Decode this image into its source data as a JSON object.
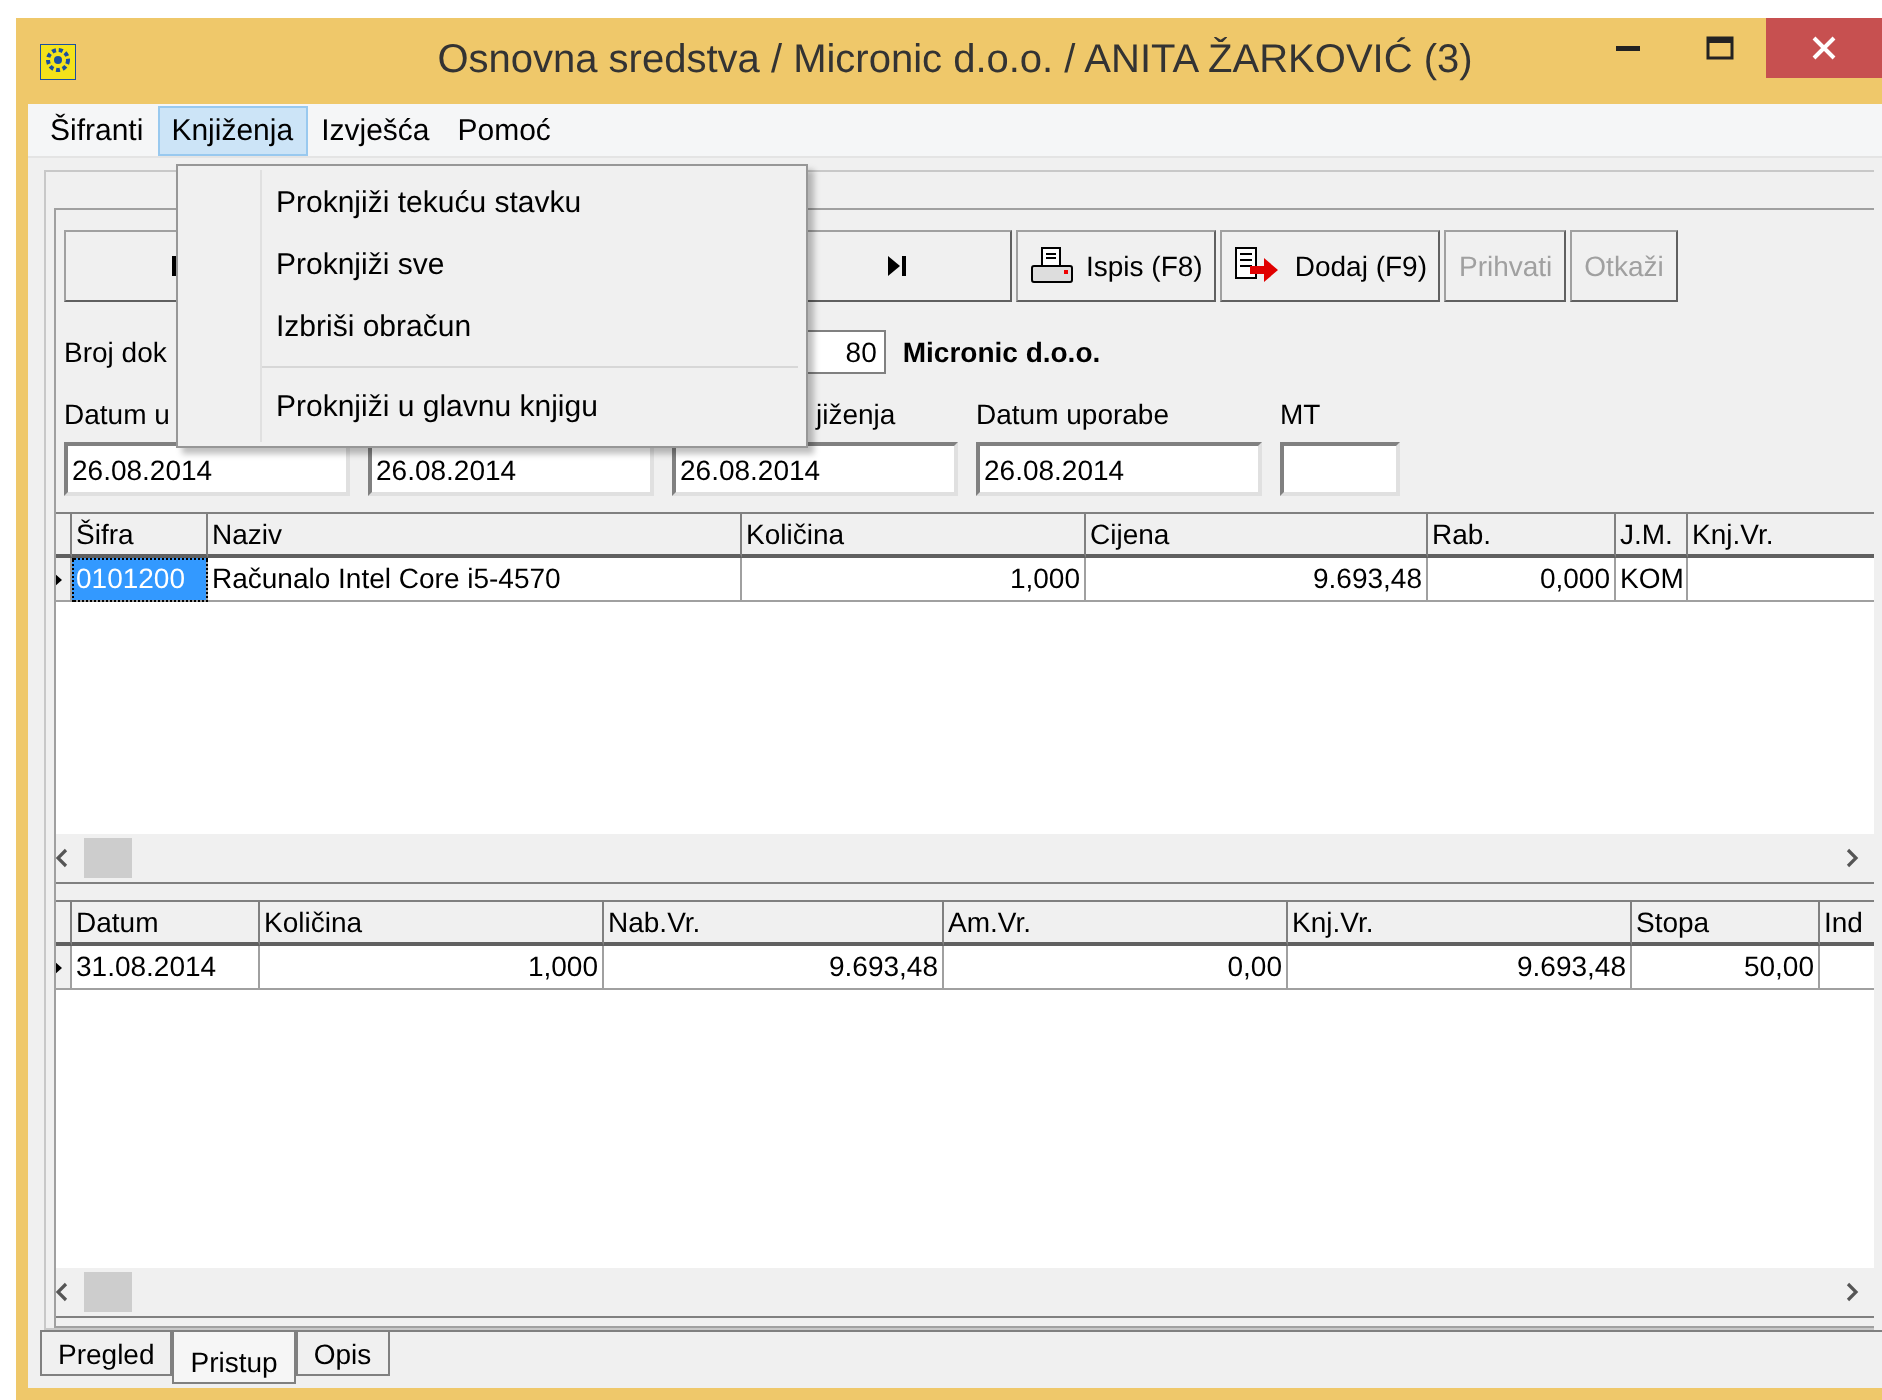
{
  "window": {
    "title": "Osnovna sredstva / Micronic d.o.o.  / ANITA ŽARKOVIĆ (3)"
  },
  "menu": [
    {
      "label": "Šifranti",
      "selected": false
    },
    {
      "label": "Knjiženja",
      "selected": true
    },
    {
      "label": "Izvješća",
      "selected": false
    },
    {
      "label": "Pomoć",
      "selected": false
    }
  ],
  "dropdown": [
    {
      "kind": "item",
      "label": "Proknjiži tekuću stavku"
    },
    {
      "kind": "item",
      "label": "Proknjiži sve"
    },
    {
      "kind": "item",
      "label": "Izbriši obračun"
    },
    {
      "kind": "separator"
    },
    {
      "kind": "item",
      "label": "Proknjiži u glavnu knjigu"
    }
  ],
  "toolbar": [
    {
      "kind": "first"
    },
    {
      "kind": "last"
    },
    {
      "kind": "print",
      "label": "Ispis (F8)",
      "disabled": false
    },
    {
      "kind": "add",
      "label": "Dodaj (F9)",
      "disabled": false
    },
    {
      "kind": "text",
      "label": "Prihvati",
      "disabled": true
    },
    {
      "kind": "text",
      "label": "Otkaži",
      "disabled": true
    }
  ],
  "document": {
    "label": "Broj dok",
    "number": "80",
    "company": "Micronic d.o.o."
  },
  "date_fields": [
    {
      "label": "Datum u",
      "value": "26.08.2014",
      "label_cut": false
    },
    {
      "value": "26.08.2014"
    },
    {
      "label": "jiženja",
      "value": "26.08.2014",
      "label_cut": true
    },
    {
      "label": "Datum uporabe",
      "value": "26.08.2014",
      "label_cut": false
    },
    {
      "label": "MT",
      "label_cut": false
    }
  ],
  "items_table": {
    "columns": [
      {
        "label": "Šifra",
        "kind": "text"
      },
      {
        "label": "Naziv",
        "kind": "text"
      },
      {
        "label": "Količina",
        "kind": "number"
      },
      {
        "label": "Cijena",
        "kind": "number"
      },
      {
        "label": "Rab.",
        "kind": "number"
      },
      {
        "label": "J.M.",
        "kind": "text"
      },
      {
        "label": "Knj.Vr.",
        "kind": "number"
      }
    ],
    "rows": [
      {
        "current": true,
        "cells": [
          {
            "text": "0101200",
            "selected": true
          },
          {
            "text": "Računalo Intel Core i5-4570",
            "selected": false
          },
          {
            "text": "1,000",
            "selected": false
          },
          {
            "text": "9.693,48",
            "selected": false
          },
          {
            "text": "0,000",
            "selected": false
          },
          {
            "text": "KOM",
            "selected": false
          },
          {
            "text": "",
            "selected": false
          }
        ]
      }
    ]
  },
  "depreciation_table": {
    "columns": [
      {
        "label": "Datum",
        "kind": "text"
      },
      {
        "label": "Količina",
        "kind": "number"
      },
      {
        "label": "Nab.Vr.",
        "kind": "number"
      },
      {
        "label": "Am.Vr.",
        "kind": "number"
      },
      {
        "label": "Knj.Vr.",
        "kind": "number"
      },
      {
        "label": "Stopa",
        "kind": "number"
      },
      {
        "label": "Ind",
        "kind": "text"
      }
    ],
    "rows": [
      {
        "current": true,
        "cells": [
          {
            "text": "31.08.2014",
            "selected": false
          },
          {
            "text": "1,000",
            "selected": false
          },
          {
            "text": "9.693,48",
            "selected": false
          },
          {
            "text": "0,00",
            "selected": false
          },
          {
            "text": "9.693,48",
            "selected": false
          },
          {
            "text": "50,00",
            "selected": false
          },
          {
            "text": "",
            "selected": false
          }
        ]
      }
    ]
  },
  "tabs": [
    {
      "label": "Pregled",
      "selected": false
    },
    {
      "label": "Pristup",
      "selected": true
    },
    {
      "label": "Opis",
      "selected": false
    }
  ]
}
